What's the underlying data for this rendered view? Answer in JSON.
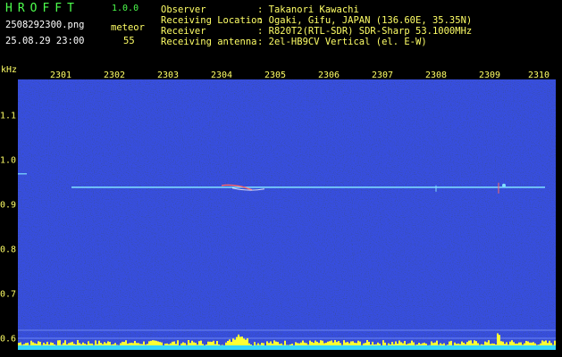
{
  "header": {
    "logo": "HROFFT",
    "version": "1.0.0",
    "filename": "2508292300.png",
    "datetime": "25.08.29 23:00",
    "meteor_label": "meteor",
    "meteor_count": "55",
    "observer_label": "Observer",
    "observer_value": ": Takanori Kawachi",
    "location_label": "Receiving Location",
    "location_value": ": Ogaki, Gifu, JAPAN (136.60E, 35.35N)",
    "receiver_label": "Receiver",
    "receiver_value": ": R820T2(RTL-SDR) SDR-Sharp 53.1000MHz",
    "antenna_label": "Receiving antenna",
    "antenna_value": ": 2el-HB9CV Vertical (el. E-W)"
  },
  "axis": {
    "y_unit": "kHz",
    "x_ticks": [
      "2301",
      "2302",
      "2303",
      "2304",
      "2305",
      "2306",
      "2307",
      "2308",
      "2309",
      "2310"
    ],
    "y_ticks": [
      "1.1",
      "1.0",
      "0.9",
      "0.8",
      "0.7",
      "0.6"
    ]
  },
  "colors": {
    "background": "#000000",
    "plot_background": "#0a1040",
    "trace": "#7fdfff",
    "axis_text": "#ffff66",
    "header_text": "#ffffff",
    "logo_text": "#4dff4d"
  },
  "chart_data": {
    "type": "heatmap",
    "xlabel": "",
    "ylabel": "kHz",
    "x_ticks": [
      "2301",
      "2302",
      "2303",
      "2304",
      "2305",
      "2306",
      "2307",
      "2308",
      "2309",
      "2310"
    ],
    "y_ticks": [
      "1.1",
      "1.0",
      "0.9",
      "0.8",
      "0.7",
      "0.6"
    ],
    "ylim": [
      0.6,
      1.1
    ],
    "grid": false,
    "carrier_khz": 0.91
  }
}
